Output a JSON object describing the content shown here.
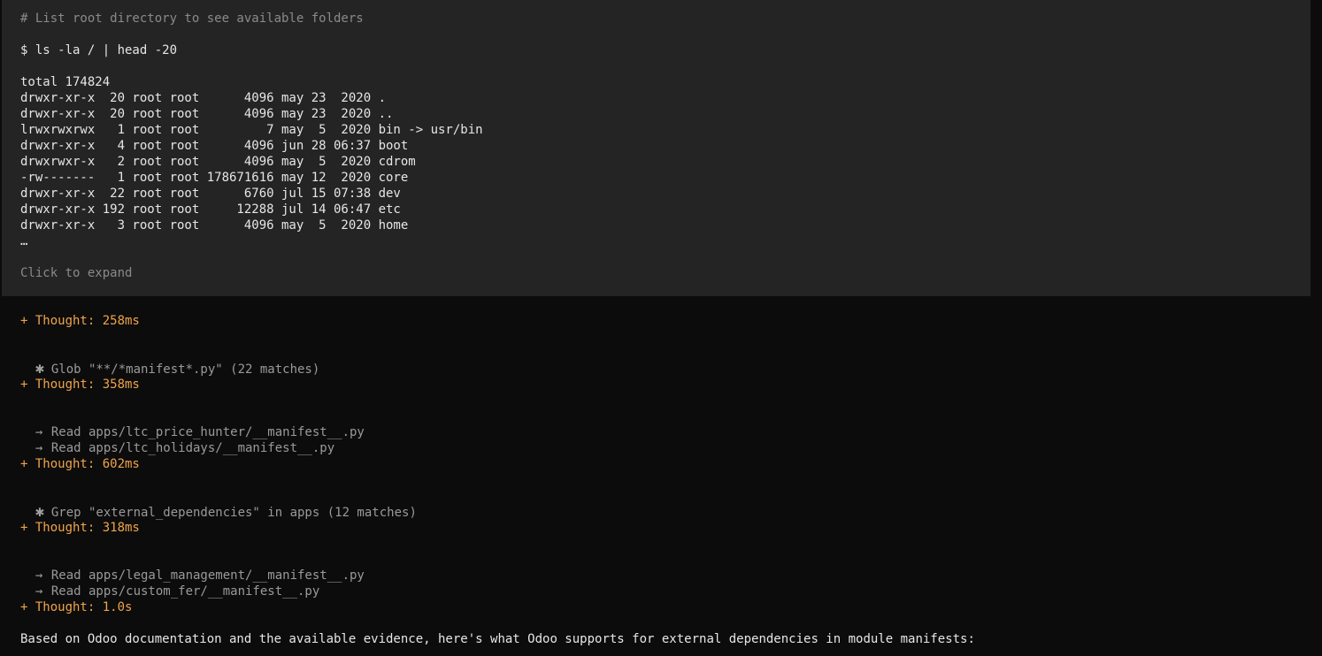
{
  "command_block": {
    "comment": "# List root directory to see available folders",
    "command": "$ ls -la / | head -20",
    "output": [
      "total 174824",
      "drwxr-xr-x  20 root root      4096 may 23  2020 .",
      "drwxr-xr-x  20 root root      4096 may 23  2020 ..",
      "lrwxrwxrwx   1 root root         7 may  5  2020 bin -> usr/bin",
      "drwxr-xr-x   4 root root      4096 jun 28 06:37 boot",
      "drwxrwxr-x   2 root root      4096 may  5  2020 cdrom",
      "-rw-------   1 root root 178671616 may 12  2020 core",
      "drwxr-xr-x  22 root root      6760 jul 15 07:38 dev",
      "drwxr-xr-x 192 root root     12288 jul 14 06:47 etc",
      "drwxr-xr-x   3 root root      4096 may  5  2020 home",
      "…"
    ],
    "expand_hint": "Click to expand"
  },
  "transcript": {
    "thought_1": "+ Thought: 258ms",
    "glob_1": "Glob \"**/*manifest*.py\" (22 matches)",
    "thought_2": "+ Thought: 358ms",
    "read_1": "Read apps/ltc_price_hunter/__manifest__.py",
    "read_2": "Read apps/ltc_holidays/__manifest__.py",
    "thought_3": "+ Thought: 602ms",
    "grep_1": "Grep \"external_dependencies\" in apps (12 matches)",
    "thought_4": "+ Thought: 318ms",
    "read_3": "Read apps/legal_management/__manifest__.py",
    "read_4": "Read apps/custom_fer/__manifest__.py",
    "thought_5": "+ Thought: 1.0s",
    "answer": "Based on Odoo documentation and the available evidence, here's what Odoo supports for external dependencies in module manifests:"
  },
  "icons": {
    "search_tool": "star-icon",
    "read_tool": "arrow-right-icon"
  },
  "colors": {
    "background": "#0c0c0c",
    "tool_block_bg": "#242424",
    "thought": "#f0a44a",
    "muted": "#8a8a8a",
    "text": "#e6e6e6"
  }
}
